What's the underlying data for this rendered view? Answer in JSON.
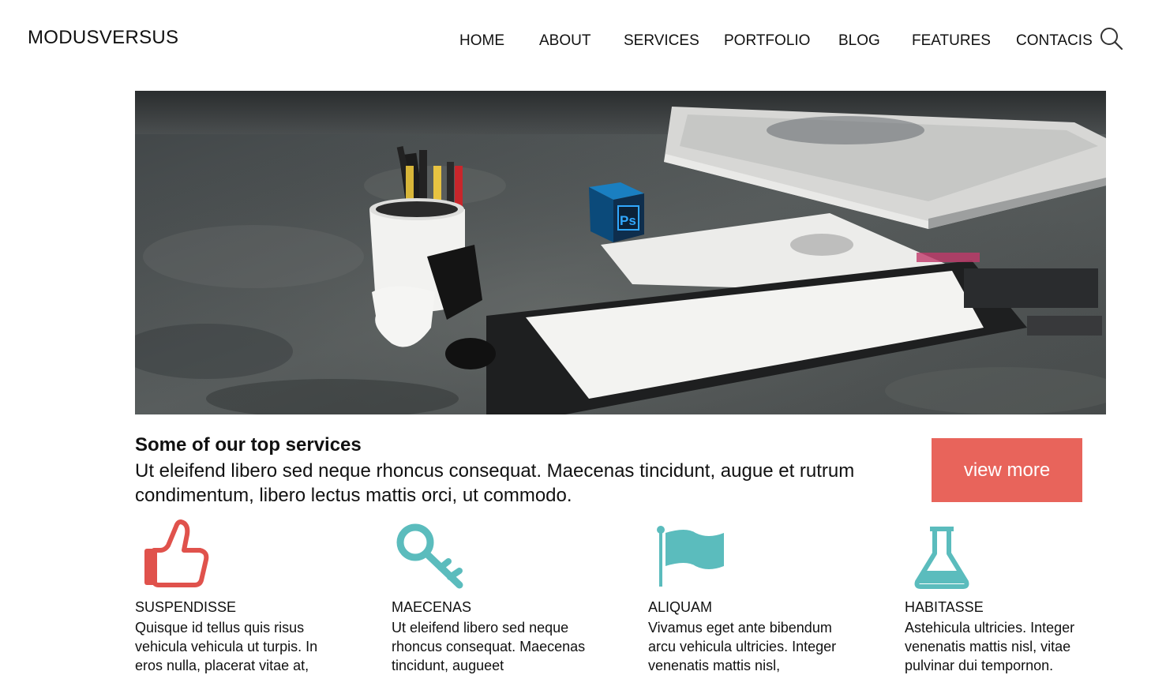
{
  "header": {
    "logo": "MODUSVERSUS",
    "nav": [
      "HOME",
      "ABOUT",
      "SERVICES",
      "PORTFOLIO",
      "BLOG",
      "FEATURES",
      "CONTACIS"
    ],
    "search_icon": "search-icon"
  },
  "hero": {
    "image": "desk-with-tablet-and-pencils",
    "ps_badge": "Ps"
  },
  "services": {
    "title": "Some of our top services",
    "text": "Ut eleifend libero sed neque rhoncus consequat. Maecenas tincidunt, augue et rutrum condimentum, libero lectus mattis orci, ut commodo.",
    "button": "view more",
    "button_color": "#e8645b"
  },
  "features": [
    {
      "icon": "thumbs-up-icon",
      "color": "#e0524c",
      "title": "SUSPENDISSE",
      "text": "Quisque id tellus quis risus vehicula vehicula ut turpis. In eros nulla, placerat vitae at,"
    },
    {
      "icon": "key-icon",
      "color": "#5bbcbd",
      "title": "MAECENAS",
      "text": "Ut eleifend libero sed neque rhoncus consequat. Maecenas tincidunt, augueet"
    },
    {
      "icon": "flag-icon",
      "color": "#5bbcbd",
      "title": "ALIQUAM",
      "text": "Vivamus eget ante bibendum arcu vehicula ultricies. Integer venenatis mattis nisl,"
    },
    {
      "icon": "flask-icon",
      "color": "#5bbcbd",
      "title": "HABITASSE",
      "text": "Astehicula ultricies. Integer venenatis mattis nisl, vitae pulvinar dui tempornon."
    }
  ]
}
